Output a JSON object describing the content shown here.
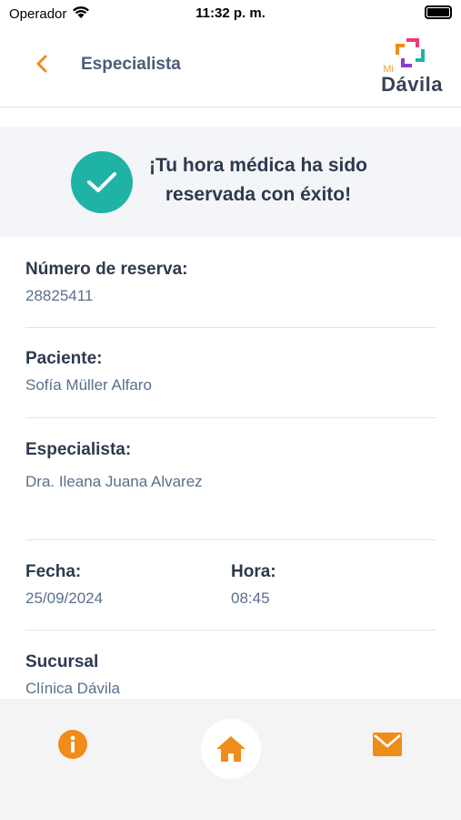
{
  "status_bar": {
    "carrier": "Operador",
    "time": "11:32 p. m.",
    "battery_level": 1.0
  },
  "nav": {
    "title": "Especialista",
    "logo_mi": "Mi",
    "logo_text": "Dávila"
  },
  "success": {
    "line1": "¡Tu hora médica ha sido",
    "line2": "reservada con éxito!"
  },
  "details": {
    "reserva": {
      "label": "Número de reserva:",
      "value": "28825411"
    },
    "paciente": {
      "label": "Paciente:",
      "value": "Sofía Müller Alfaro"
    },
    "especialista": {
      "label": "Especialista:",
      "value": "Dra. Ileana Juana Alvarez"
    },
    "fecha": {
      "label": "Fecha:",
      "value": "25/09/2024"
    },
    "hora": {
      "label": "Hora:",
      "value": "08:45"
    },
    "sucursal": {
      "label": "Sucursal",
      "value": "Clínica Dávila"
    }
  },
  "colors": {
    "accent_orange": "#f08c1a",
    "success_teal": "#1fb3a6",
    "label_dark": "#2d3a4d",
    "value_blue": "#5a6f8c"
  },
  "tabbar": {
    "icons": [
      "info-icon",
      "home-icon",
      "mail-icon"
    ]
  }
}
